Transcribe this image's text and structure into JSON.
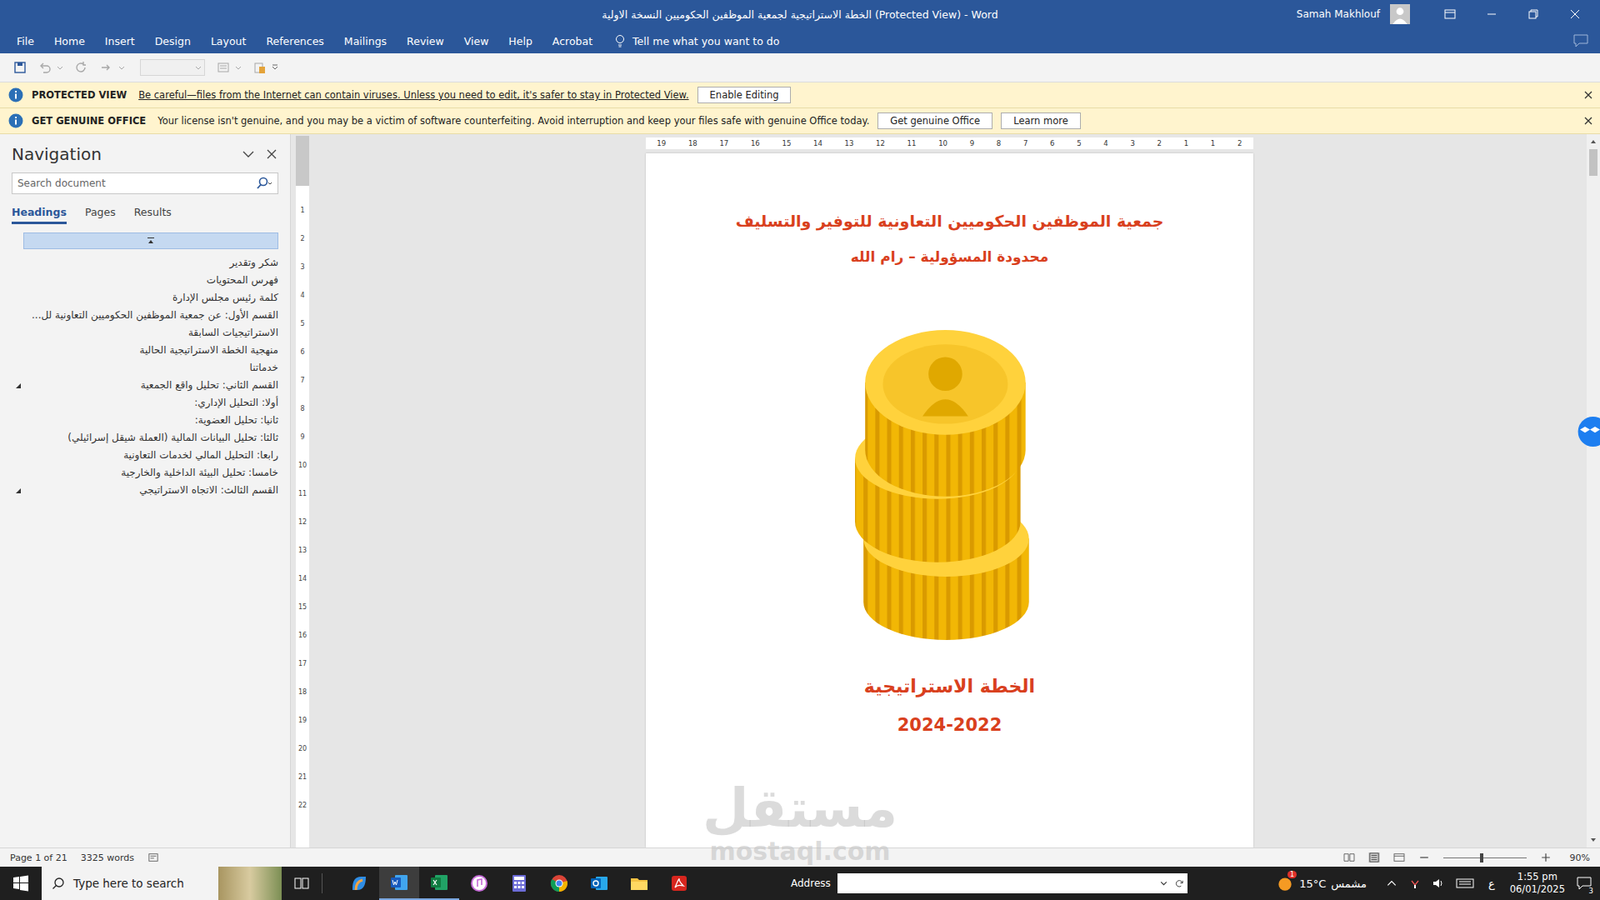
{
  "window": {
    "title": "الخطة الاستراتيجية لجمعية الموظفين الحكوميين النسخة الاولية (Protected View)  -  Word",
    "user": "Samah Makhlouf"
  },
  "ribbon_tabs": [
    "File",
    "Home",
    "Insert",
    "Design",
    "Layout",
    "References",
    "Mailings",
    "Review",
    "View",
    "Help",
    "Acrobat"
  ],
  "tell_me": "Tell me what you want to do",
  "message_bars": [
    {
      "label": "PROTECTED VIEW",
      "text": "Be careful—files from the Internet can contain viruses. Unless you need to edit, it's safer to stay in Protected View.",
      "link": true,
      "buttons": [
        "Enable Editing"
      ]
    },
    {
      "label": "GET GENUINE OFFICE",
      "text": "Your license isn't genuine, and you may be a victim of software counterfeiting. Avoid interruption and keep your files safe with genuine Office today.",
      "link": false,
      "buttons": [
        "Get genuine Office",
        "Learn more"
      ]
    }
  ],
  "navigation": {
    "title": "Navigation",
    "search_placeholder": "Search document",
    "tabs": [
      {
        "label": "Headings",
        "selected": true
      },
      {
        "label": "Pages",
        "selected": false
      },
      {
        "label": "Results",
        "selected": false
      }
    ],
    "top_row_selected": true,
    "headings": [
      {
        "text": "شكر وتقدير",
        "kind": "leaf",
        "expanded": false
      },
      {
        "text": "فهرس المحتويات",
        "kind": "leaf",
        "expanded": false
      },
      {
        "text": "كلمة رئيس مجلس الإدارة",
        "kind": "leaf",
        "expanded": false
      },
      {
        "text": "القسم الأول: عن جمعية الموظفين الحكوميين التعاونية لل...",
        "kind": "leaf",
        "expanded": false
      },
      {
        "text": "الاستراتيجيات السابقة",
        "kind": "leaf",
        "expanded": false
      },
      {
        "text": "منهجية الخطة الاستراتيجية الحالية",
        "kind": "leaf",
        "expanded": false
      },
      {
        "text": "خدماتنا",
        "kind": "leaf",
        "expanded": false
      },
      {
        "text": "القسم الثاني: تحليل واقع الجمعية",
        "kind": "parent",
        "expanded": true
      },
      {
        "text": "أولا: التحليل الإداري:",
        "kind": "leaf",
        "expanded": false
      },
      {
        "text": "ثانيا: تحليل العضوية:",
        "kind": "leaf",
        "expanded": false
      },
      {
        "text": "ثالثا: تحليل البيانات المالية (العملة شيقل إسرائيلي)",
        "kind": "leaf",
        "expanded": false
      },
      {
        "text": "رابعا: التحليل المالي لخدمات التعاونية",
        "kind": "leaf",
        "expanded": false
      },
      {
        "text": "خامسا: تحليل البيئة الداخلية والخارجية",
        "kind": "leaf",
        "expanded": false
      },
      {
        "text": "القسم الثالث: الاتجاه الاستراتيجي",
        "kind": "parent",
        "expanded": true
      }
    ]
  },
  "ruler": {
    "horizontal": [
      "19",
      "18",
      "17",
      "16",
      "15",
      "14",
      "13",
      "12",
      "11",
      "10",
      "9",
      "8",
      "7",
      "6",
      "5",
      "4",
      "3",
      "2",
      "1",
      "1",
      "2"
    ],
    "vertical": [
      "1",
      "2",
      "3",
      "4",
      "5",
      "6",
      "7",
      "8",
      "9",
      "10",
      "11",
      "12",
      "13",
      "14",
      "15",
      "16",
      "17",
      "18",
      "19",
      "20",
      "21",
      "22"
    ]
  },
  "document": {
    "organization": "جمعية الموظفين الحكوميين التعاونية للتوفير والتسليف",
    "subtitle": "محدودة المسؤولية – رام الله",
    "title": "الخطة الاستراتيجية",
    "years": "2024-2022"
  },
  "status_bar": {
    "page": "Page 1 of 21",
    "words": "3325 words",
    "zoom": "90%",
    "zoom_level": 0.46
  },
  "taskbar": {
    "search_placeholder": "Type here to search",
    "apps": [
      {
        "kind": "copilot",
        "open": false,
        "active": false
      },
      {
        "kind": "word",
        "open": true,
        "active": true
      },
      {
        "kind": "excel",
        "open": true,
        "active": false
      },
      {
        "kind": "itunes",
        "open": false,
        "active": false
      },
      {
        "kind": "calculator",
        "open": false,
        "active": false
      },
      {
        "kind": "chrome",
        "open": false,
        "active": false
      },
      {
        "kind": "outlook",
        "open": false,
        "active": false
      },
      {
        "kind": "explorer",
        "open": false,
        "active": false
      },
      {
        "kind": "acrobat",
        "open": false,
        "active": false
      }
    ],
    "address_label": "Address",
    "weather_badge": "1",
    "temperature": "15°C",
    "condition": "مشمس",
    "language": "ع",
    "time": "1:55 pm",
    "date": "06/01/2025",
    "notifications": "3"
  },
  "watermark": {
    "arabic": "مستقل",
    "latin": "mostaql.com"
  }
}
